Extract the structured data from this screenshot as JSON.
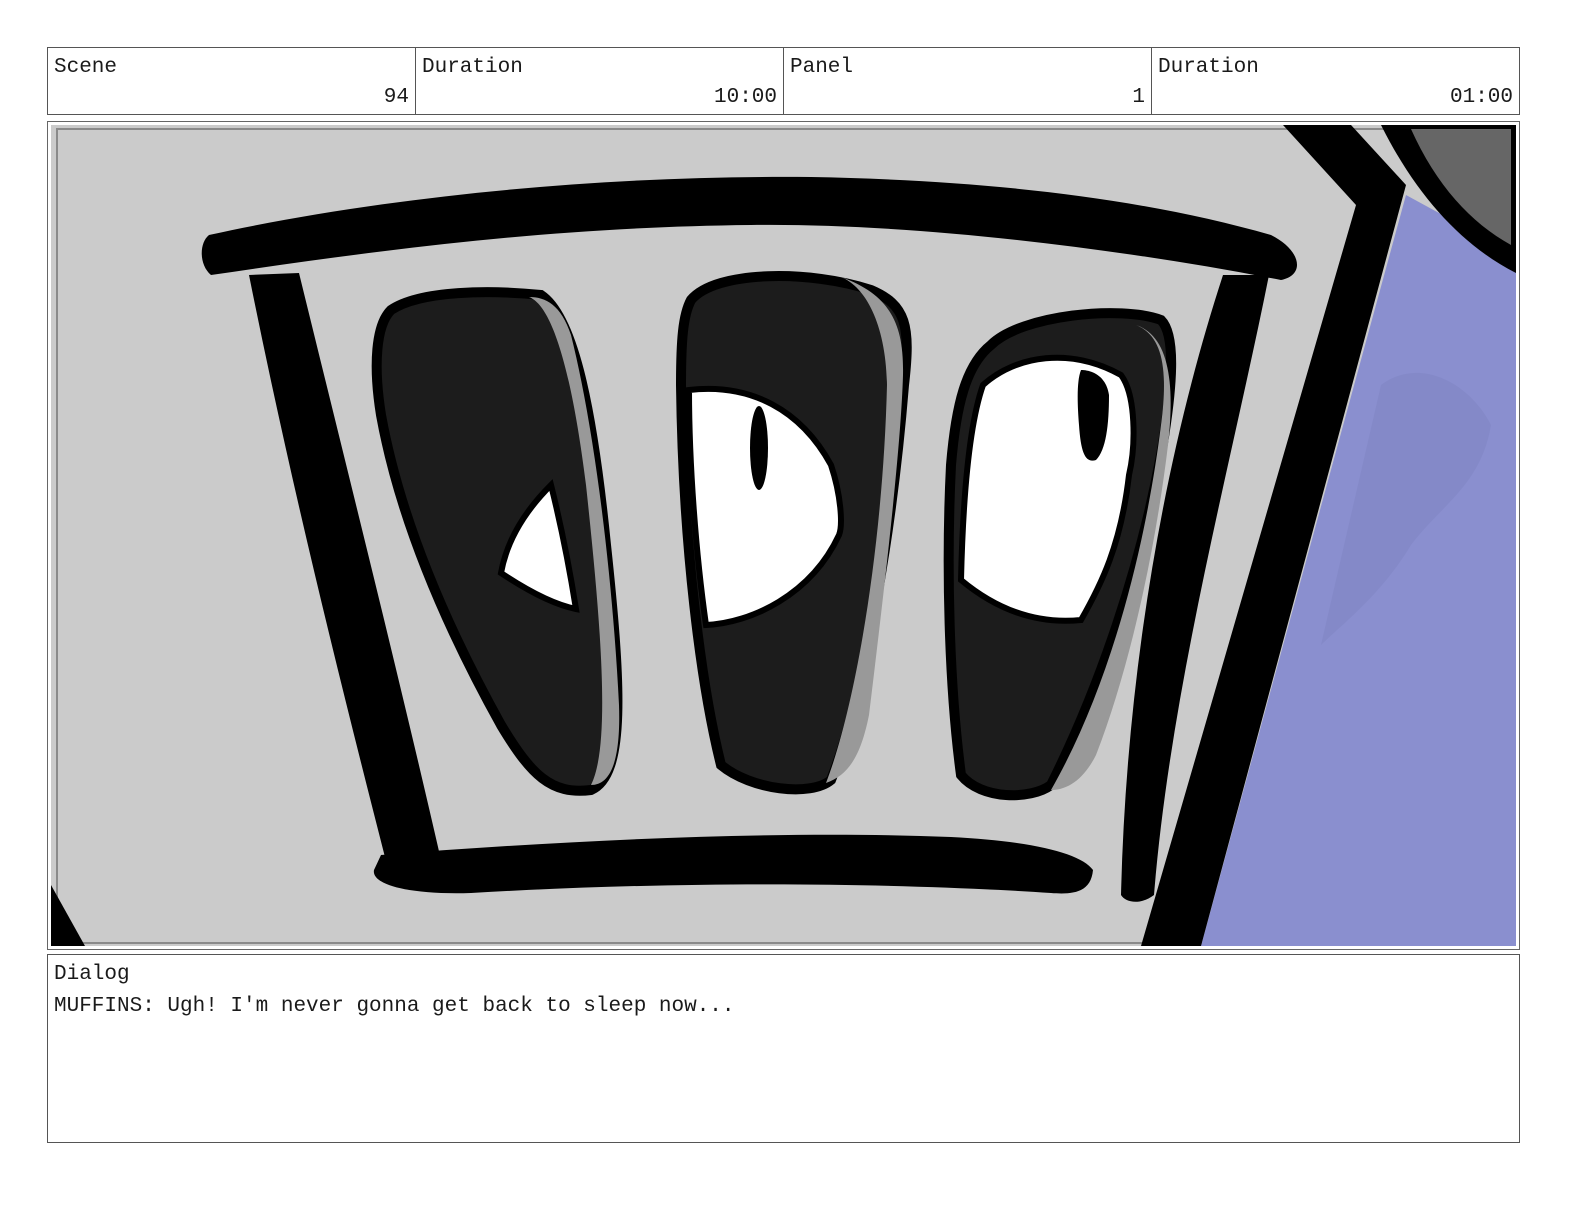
{
  "header": {
    "scene_label": "Scene",
    "scene_value": "94",
    "scene_duration_label": "Duration",
    "scene_duration_value": "10:00",
    "panel_label": "Panel",
    "panel_value": "1",
    "panel_duration_label": "Duration",
    "panel_duration_value": "01:00"
  },
  "dialog": {
    "label": "Dialog",
    "text": "MUFFINS: Ugh! I'm never gonna get back to sleep now..."
  },
  "colors": {
    "background_gray": "#cbcbcb",
    "outline": "#000000",
    "slot_dark": "#1c1c1c",
    "slot_highlight": "#999999",
    "sky_blue": "#8a8fcf",
    "eye_white": "#ffffff"
  }
}
